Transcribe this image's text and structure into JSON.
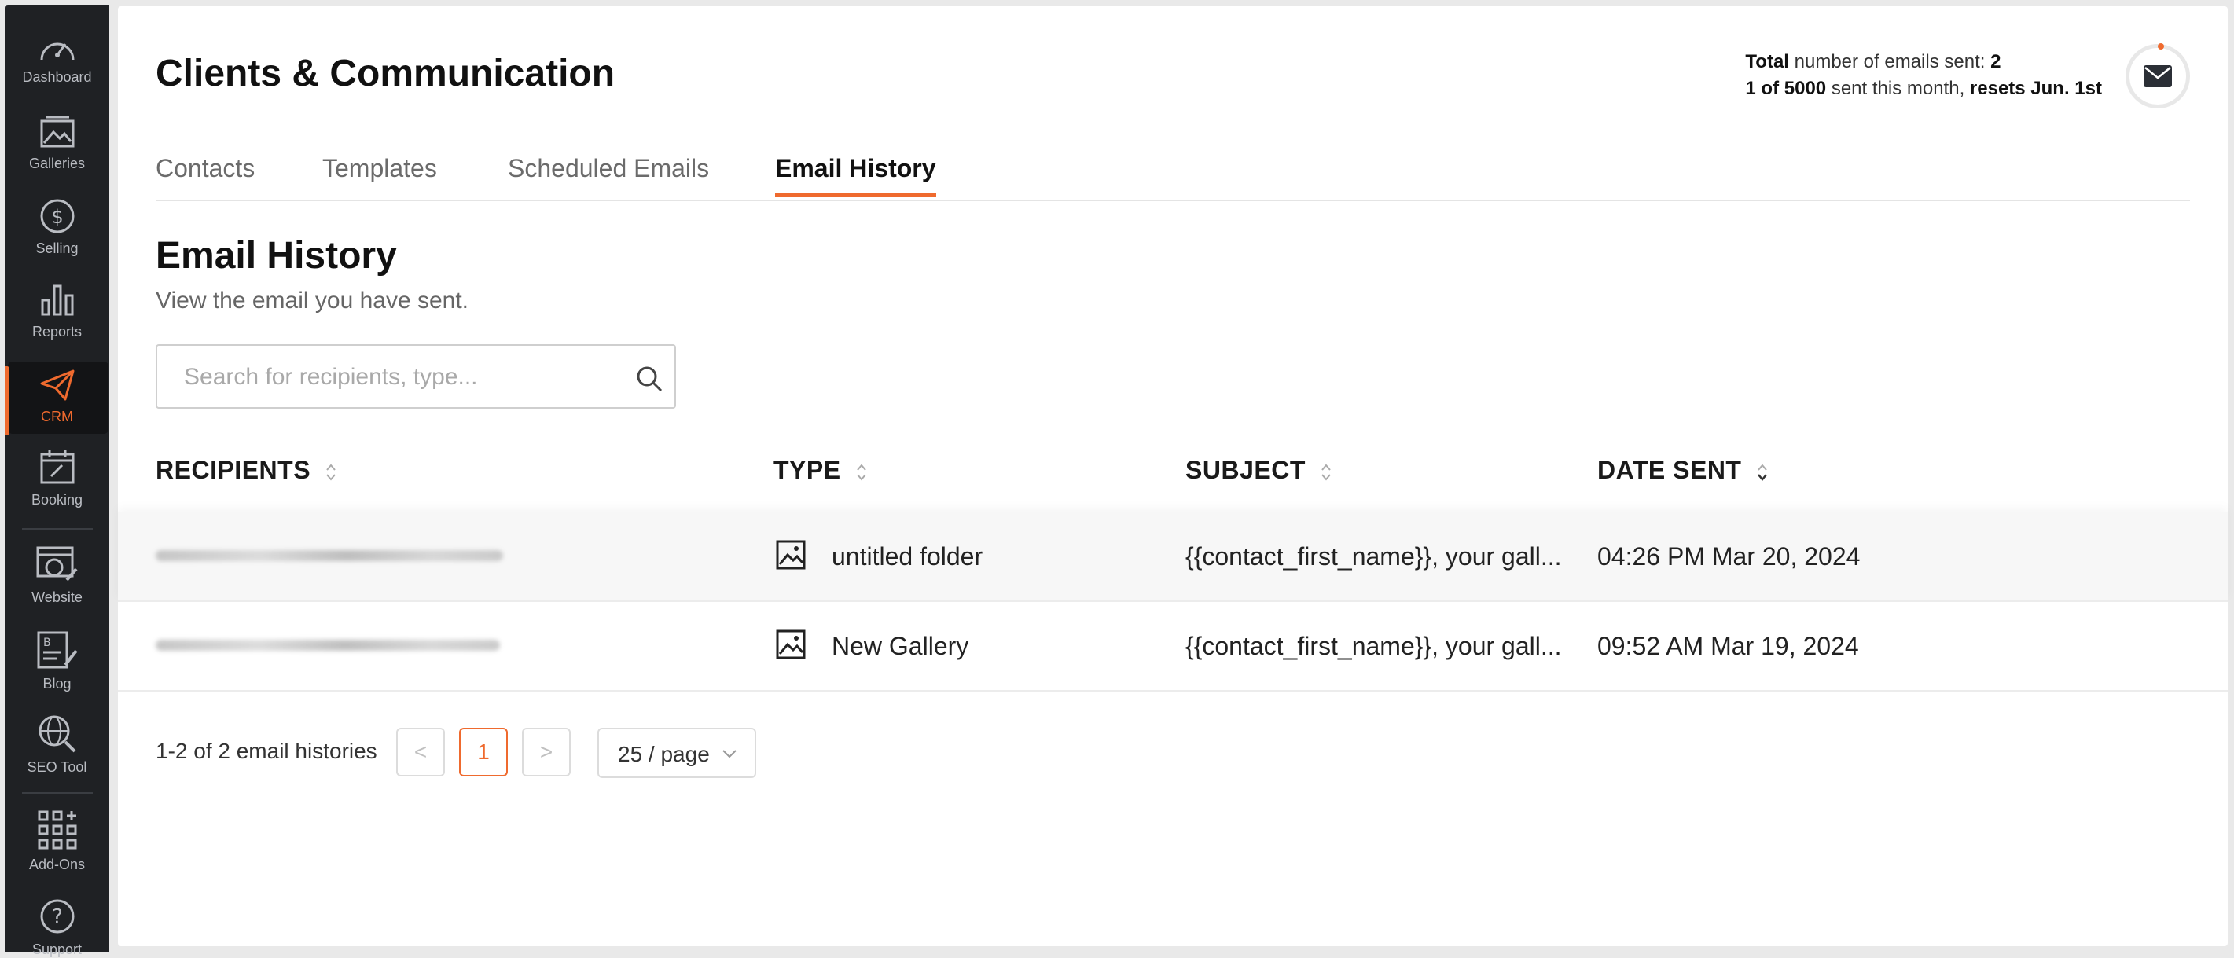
{
  "sidebar": {
    "items": [
      {
        "label": "Dashboard",
        "icon": "gauge-icon"
      },
      {
        "label": "Galleries",
        "icon": "image-icon"
      },
      {
        "label": "Selling",
        "icon": "dollar-icon"
      },
      {
        "label": "Reports",
        "icon": "bar-chart-icon"
      },
      {
        "label": "CRM",
        "icon": "paper-plane-icon",
        "active": true
      },
      {
        "label": "Booking",
        "icon": "calendar-icon"
      },
      {
        "label": "Website",
        "icon": "globe-edit-icon"
      },
      {
        "label": "Blog",
        "icon": "blog-edit-icon"
      },
      {
        "label": "SEO Tool",
        "icon": "seo-globe-icon"
      },
      {
        "label": "Add-Ons",
        "icon": "grid-plus-icon"
      },
      {
        "label": "Support",
        "icon": "help-icon"
      }
    ],
    "accent": "#ef6a2e"
  },
  "header": {
    "title": "Clients & Communication",
    "stats": {
      "total_label": "Total",
      "total_text": "number of emails sent:",
      "total_value": "2",
      "monthly_value": "1 of 5000",
      "monthly_text": "sent this month,",
      "reset_text": "resets Jun. 1st"
    }
  },
  "tabs": [
    {
      "label": "Contacts"
    },
    {
      "label": "Templates"
    },
    {
      "label": "Scheduled Emails"
    },
    {
      "label": "Email History",
      "active": true
    }
  ],
  "section": {
    "title": "Email History",
    "subtitle": "View the email you have sent."
  },
  "search": {
    "placeholder": "Search for recipients, type...",
    "value": ""
  },
  "table": {
    "columns": [
      "RECIPIENTS",
      "TYPE",
      "SUBJECT",
      "DATE SENT"
    ],
    "rows": [
      {
        "recipient": "",
        "type": "untitled folder",
        "subject": "{{contact_first_name}}, your gall...",
        "date_sent": "04:26 PM Mar 20, 2024"
      },
      {
        "recipient": "",
        "type": "New Gallery",
        "subject": "{{contact_first_name}}, your gall...",
        "date_sent": "09:52 AM Mar 19, 2024"
      }
    ]
  },
  "pagination": {
    "summary": "1-2 of 2 email histories",
    "prev": "<",
    "current_page": "1",
    "next": ">",
    "page_size": "25 / page"
  }
}
